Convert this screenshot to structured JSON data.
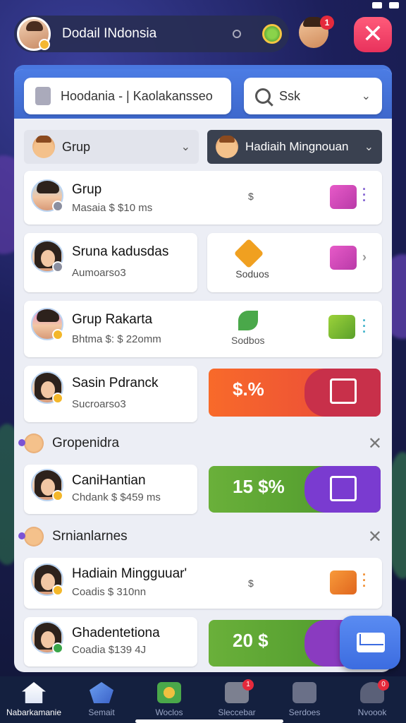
{
  "header": {
    "title": "Dodail INdonsia",
    "notification_count": "1"
  },
  "search": {
    "left_value": "Hoodania - | Kaolakansseo",
    "right_value": "Ssk"
  },
  "filters": {
    "left": "Grup",
    "right": "Hadiaih Mingnouan"
  },
  "list": [
    {
      "name": "Grup",
      "sub": "Masaia $ $10 ms",
      "mid": "$"
    },
    {
      "name": "Sruna kadusdas",
      "sub": "Aumoarso3",
      "side": "Soduos"
    },
    {
      "name": "Grup Rakarta",
      "sub": "Bhtma $: $ 22omm",
      "side": "Sodbos"
    },
    {
      "name": "Sasin Pdranck",
      "sub": "Sucroarso3",
      "promo": "$.%"
    }
  ],
  "sections": [
    {
      "title": "Gropenidra"
    },
    {
      "title": "Srnianlarnes"
    }
  ],
  "section_items": [
    {
      "name": "CaniHantian",
      "sub": "Chdank $ $459 ms",
      "promo": "15 $%"
    },
    {
      "name": "Hadiain Mingguuar'",
      "sub": "Coadis $ 310nn",
      "mid": "$"
    },
    {
      "name": "Ghadentetiona",
      "sub": "Coadia $139 4J",
      "promo": "20 $"
    }
  ],
  "nav": [
    {
      "label": "Nabarkamanie"
    },
    {
      "label": "Semait"
    },
    {
      "label": "Woclos"
    },
    {
      "label": "Sleccebar",
      "badge": "1"
    },
    {
      "label": "Serdoes"
    },
    {
      "label": "Nvoook",
      "badge": "0"
    }
  ],
  "colors": {
    "accent": "#4a78e0",
    "close": "#e8325c",
    "promo_orange": "#f0612a",
    "promo_green": "#5aa83a",
    "promo_purple": "#6b3bc8"
  }
}
